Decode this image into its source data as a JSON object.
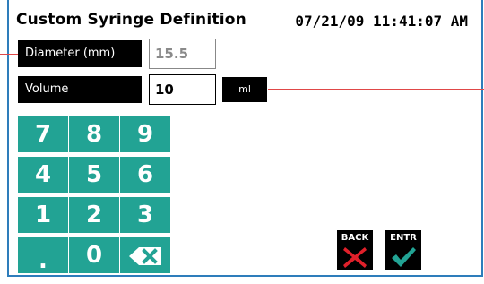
{
  "header": {
    "title": "Custom Syringe Definition",
    "datetime": "07/21/09 11:41:07 AM"
  },
  "fields": {
    "diameter": {
      "label": "Diameter (mm)",
      "value": "15.5"
    },
    "volume": {
      "label": "Volume",
      "value": "10",
      "unit": "ml"
    }
  },
  "keypad": {
    "keys": [
      "7",
      "8",
      "9",
      "4",
      "5",
      "6",
      "1",
      "2",
      "3",
      ".",
      "0"
    ],
    "backspace_icon": "backspace-icon"
  },
  "actions": {
    "back": {
      "label": "BACK",
      "icon": "red-x-icon"
    },
    "enter": {
      "label": "ENTR",
      "icon": "green-check-icon"
    }
  },
  "colors": {
    "key_bg": "#22a394",
    "frame": "#2e7dbb",
    "leader": "#e04848",
    "x": "#e0202a",
    "check": "#22a394"
  }
}
